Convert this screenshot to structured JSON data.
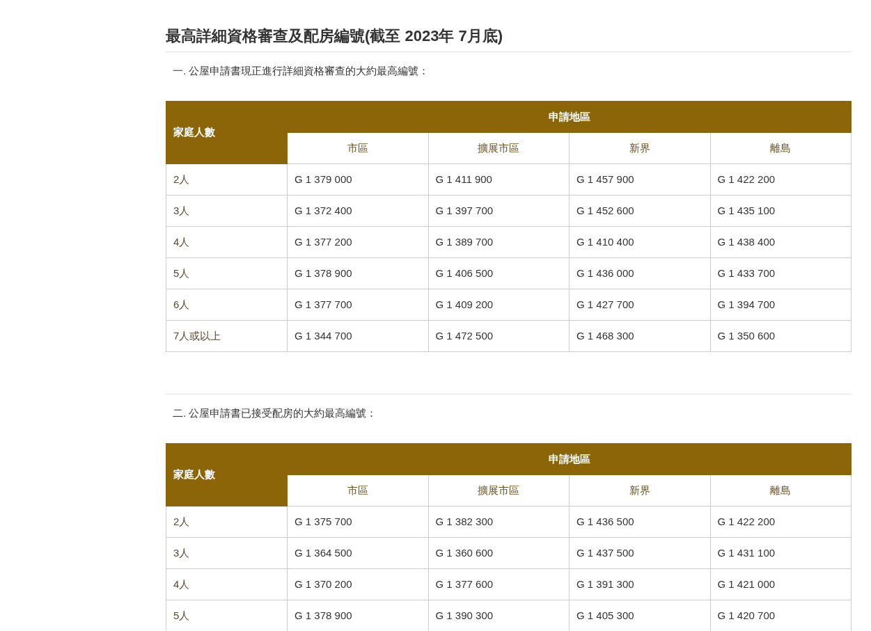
{
  "title": "最高詳細資格審查及配房編號(截至 2023年 7月底)",
  "sections": [
    {
      "heading": "一. 公屋申請書現正進行詳細資格審查的大約最高編號：",
      "table": {
        "corner": "家庭人數",
        "group": "申請地區",
        "columns": [
          "市區",
          "擴展市區",
          "新界",
          "離島"
        ],
        "rows": [
          {
            "label": "2人",
            "cells": [
              "G 1 379 000",
              "G 1 411 900",
              "G 1 457 900",
              "G 1 422 200"
            ]
          },
          {
            "label": "3人",
            "cells": [
              "G 1 372 400",
              "G 1 397 700",
              "G 1 452 600",
              "G 1 435 100"
            ]
          },
          {
            "label": "4人",
            "cells": [
              "G 1 377 200",
              "G 1 389 700",
              "G 1 410 400",
              "G 1 438 400"
            ]
          },
          {
            "label": "5人",
            "cells": [
              "G 1 378 900",
              "G 1 406 500",
              "G 1 436 000",
              "G 1 433 700"
            ]
          },
          {
            "label": "6人",
            "cells": [
              "G 1 377 700",
              "G 1 409 200",
              "G 1 427 700",
              "G 1 394 700"
            ]
          },
          {
            "label": "7人或以上",
            "cells": [
              "G 1 344 700",
              "G 1 472 500",
              "G 1 468 300",
              "G 1 350 600"
            ]
          }
        ]
      }
    },
    {
      "heading": "二. 公屋申請書已接受配房的大約最高編號：",
      "table": {
        "corner": "家庭人數",
        "group": "申請地區",
        "columns": [
          "市區",
          "擴展市區",
          "新界",
          "離島"
        ],
        "rows": [
          {
            "label": "2人",
            "cells": [
              "G 1 375 700",
              "G 1 382 300",
              "G 1 436 500",
              "G 1 422 200"
            ]
          },
          {
            "label": "3人",
            "cells": [
              "G 1 364 500",
              "G 1 360 600",
              "G 1 437 500",
              "G 1 431 100"
            ]
          },
          {
            "label": "4人",
            "cells": [
              "G 1 370 200",
              "G 1 377 600",
              "G 1 391 300",
              "G 1 421 000"
            ]
          },
          {
            "label": "5人",
            "cells": [
              "G 1 378 900",
              "G 1 390 300",
              "G 1 405 300",
              "G 1 420 700"
            ]
          }
        ]
      }
    }
  ]
}
